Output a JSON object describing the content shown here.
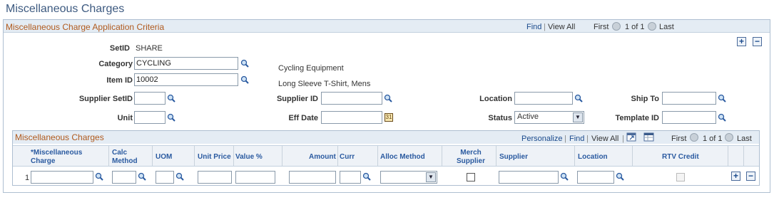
{
  "page": {
    "title": "Miscellaneous Charges"
  },
  "criteria": {
    "title": "Miscellaneous Charge Application Criteria",
    "nav": {
      "find": "Find",
      "sep": "|",
      "view_all": "View All",
      "first": "First",
      "count": "1 of 1",
      "last": "Last"
    },
    "setid_label": "SetID",
    "setid_value": "SHARE",
    "category_label": "Category",
    "category_value": "CYCLING",
    "category_desc": "Cycling Equipment",
    "item_label": "Item ID",
    "item_value": "10002",
    "item_desc": "Long Sleeve T-Shirt, Mens",
    "supplier_setid_label": "Supplier SetID",
    "supplier_id_label": "Supplier ID",
    "location_label": "Location",
    "ship_to_label": "Ship To",
    "unit_label": "Unit",
    "eff_date_label": "Eff Date",
    "status_label": "Status",
    "status_value": "Active",
    "template_label": "Template ID"
  },
  "grid": {
    "title": "Miscellaneous Charges",
    "nav": {
      "personalize": "Personalize",
      "find": "Find",
      "view_all": "View All",
      "first": "First",
      "count": "1 of 1",
      "last": "Last"
    },
    "columns": {
      "misc_charge_1": "*Miscellaneous",
      "misc_charge_2": "Charge",
      "calc_1": "Calc",
      "calc_2": "Method",
      "uom": "UOM",
      "unit_price": "Unit Price",
      "value_pct": "Value %",
      "amount": "Amount",
      "curr": "Curr",
      "alloc": "Alloc Method",
      "merch_1": "Merch",
      "merch_2": "Supplier",
      "supplier": "Supplier",
      "location": "Location",
      "rtv": "RTV Credit"
    },
    "row": {
      "number": "1"
    }
  },
  "colors": {
    "accent": "#b05a1e",
    "link": "#1a4a8c",
    "header_bg": "#e4ecf4"
  }
}
